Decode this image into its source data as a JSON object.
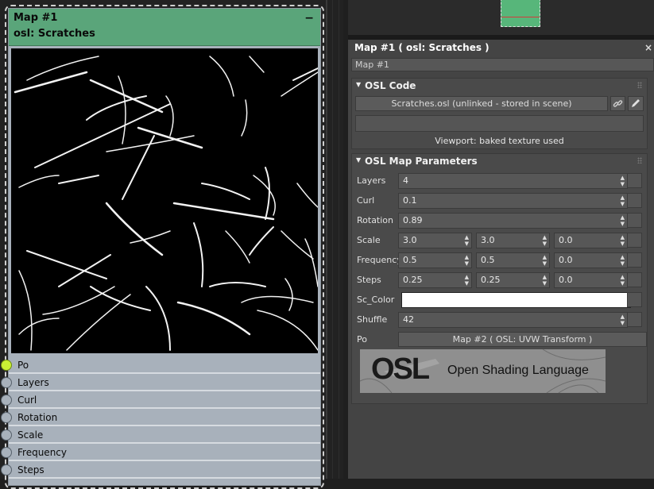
{
  "node": {
    "title": "Map #1",
    "subtitle": "osl: Scratches",
    "collapse_glyph": "−",
    "ports": [
      "Po",
      "Layers",
      "Curl",
      "Rotation",
      "Scale",
      "Frequency",
      "Steps"
    ]
  },
  "panel": {
    "title": "Map #1  ( osl: Scratches )",
    "close_glyph": "×",
    "name_value": "Map #1",
    "osl_code": {
      "header": "OSL Code",
      "file_button": "Scratches.osl (unlinked - stored in scene)",
      "link_icon": "link-icon",
      "edit_icon": "pencil-icon",
      "viewport_note": "Viewport: baked texture used"
    },
    "params": {
      "header": "OSL Map Parameters",
      "layers": {
        "label": "Layers",
        "value": "4"
      },
      "curl": {
        "label": "Curl",
        "value": "0.1"
      },
      "rotation": {
        "label": "Rotation",
        "value": "0.89"
      },
      "scale": {
        "label": "Scale",
        "v1": "3.0",
        "v2": "3.0",
        "v3": "0.0"
      },
      "frequency": {
        "label": "Frequency",
        "v1": "0.5",
        "v2": "0.5",
        "v3": "0.0"
      },
      "steps": {
        "label": "Steps",
        "v1": "0.25",
        "v2": "0.25",
        "v3": "0.0"
      },
      "sc_color": {
        "label": "Sc_Color",
        "color": "#ffffff"
      },
      "shuffle": {
        "label": "Shuffle",
        "value": "42"
      },
      "po": {
        "label": "Po",
        "map": "Map #2  ( OSL: UVW Transform )"
      }
    },
    "logo": {
      "mark": "OSL",
      "text": "Open Shading Language"
    }
  },
  "colors": {
    "node_header": "#5aa57a",
    "node_body": "#a8b1bb",
    "active_socket": "#c9f035",
    "panel_bg": "#444444",
    "swatch": "#57b67a"
  }
}
